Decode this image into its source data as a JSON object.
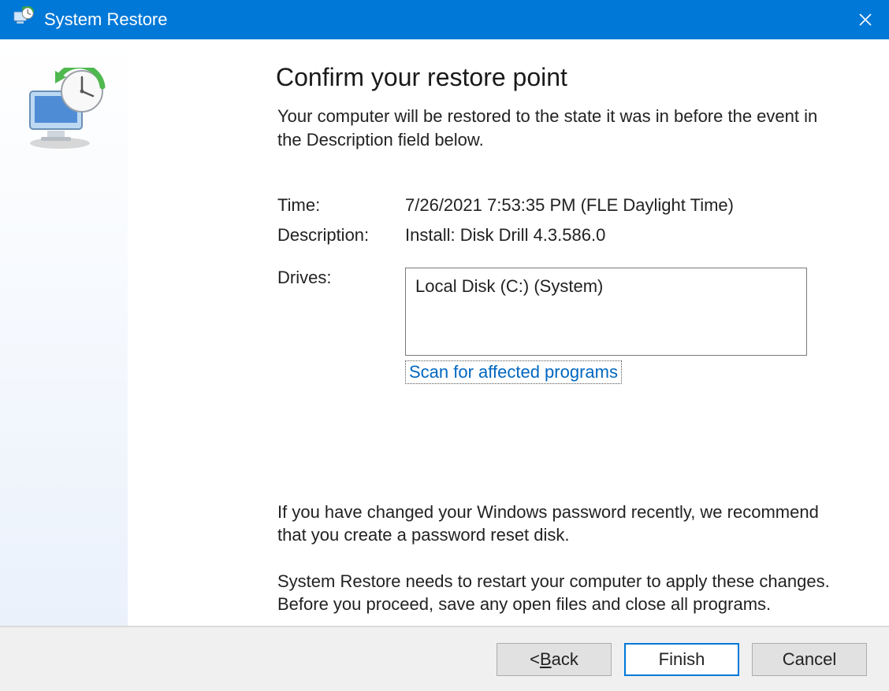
{
  "titlebar": {
    "title": "System Restore"
  },
  "page": {
    "heading": "Confirm your restore point",
    "lead": "Your computer will be restored to the state it was in before the event in the Description field below.",
    "time_label": "Time:",
    "time_value": "7/26/2021 7:53:35 PM (FLE Daylight Time)",
    "description_label": "Description:",
    "description_value": "Install: Disk Drill 4.3.586.0",
    "drives_label": "Drives:",
    "drives_value": "Local Disk (C:) (System)",
    "scan_link": "Scan for affected programs",
    "note_password": "If you have changed your Windows password recently, we recommend that you create a password reset disk.",
    "note_restart": "System Restore needs to restart your computer to apply these changes. Before you proceed, save any open files and close all programs."
  },
  "buttons": {
    "back_prefix": "< ",
    "back_u": "B",
    "back_suffix": "ack",
    "finish": "Finish",
    "cancel": "Cancel"
  }
}
